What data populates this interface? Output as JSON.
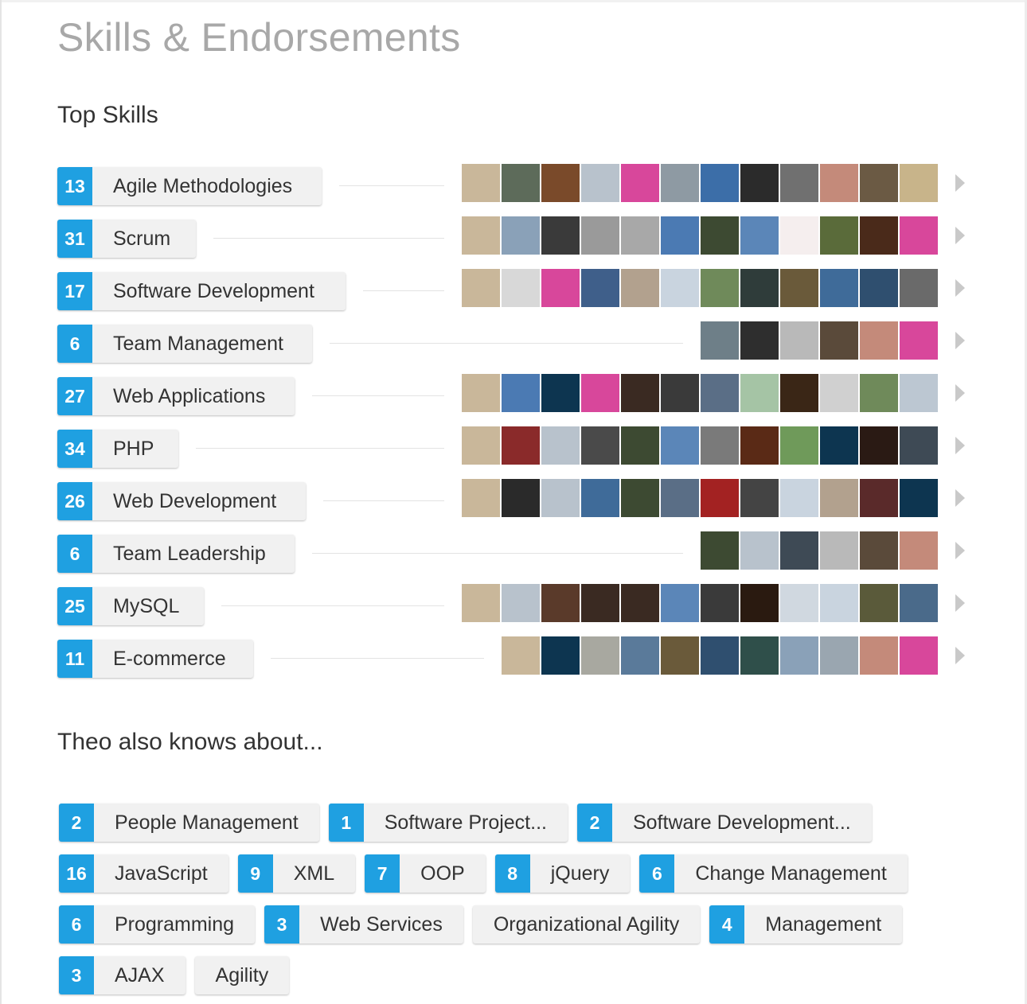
{
  "page": {
    "title": "Skills & Endorsements"
  },
  "top_skills": {
    "heading": "Top Skills",
    "items": [
      {
        "count": "13",
        "name": "Agile Methodologies",
        "endorser_colors": [
          "#c9b79a",
          "#5d6b5a",
          "#7a4a2a",
          "#b8c2cc",
          "#d8479b",
          "#8e9aa3",
          "#3c6ea8",
          "#2b2b2b",
          "#707070",
          "#c48a7a",
          "#6b5a44",
          "#c8b48a"
        ]
      },
      {
        "count": "31",
        "name": "Scrum",
        "endorser_colors": [
          "#c9b79a",
          "#8aa1b8",
          "#3a3a3a",
          "#9a9a9a",
          "#a8a8a8",
          "#4b7ab3",
          "#3d4a32",
          "#5b86b8",
          "#f5eeee",
          "#5a6b3a",
          "#4a2a1a",
          "#d8479b"
        ]
      },
      {
        "count": "17",
        "name": "Software Development",
        "endorser_colors": [
          "#c9b79a",
          "#d8d8d8",
          "#d8479b",
          "#3f5f8a",
          "#b2a18e",
          "#c9d4df",
          "#6f8a5a",
          "#2f3c3a",
          "#6a5a3a",
          "#3f6b99",
          "#2f4f6f",
          "#6a6a6a"
        ]
      },
      {
        "count": "6",
        "name": "Team Management",
        "endorser_colors": [
          "#6e7f88",
          "#2e2e2e",
          "#b9b9b9",
          "#5a4a3a",
          "#c48a7a",
          "#d8479b"
        ]
      },
      {
        "count": "27",
        "name": "Web Applications",
        "endorser_colors": [
          "#c9b79a",
          "#4b7ab3",
          "#0d3550",
          "#d8479b",
          "#3a2a22",
          "#3a3a3a",
          "#5a6e86",
          "#a5c4a5",
          "#3a2616",
          "#d0d0d0",
          "#6f8a5a",
          "#bcc7d2"
        ]
      },
      {
        "count": "34",
        "name": "PHP",
        "endorser_colors": [
          "#c9b79a",
          "#8a2a2a",
          "#b8c2cc",
          "#4a4a4a",
          "#3d4a32",
          "#5b86b8",
          "#7a7a7a",
          "#5a2a16",
          "#6f9a5a",
          "#0d3550",
          "#2a1a14",
          "#3e4a55"
        ]
      },
      {
        "count": "26",
        "name": "Web Development",
        "endorser_colors": [
          "#c9b79a",
          "#2a2a2a",
          "#b8c2cc",
          "#3f6b99",
          "#3d4a32",
          "#5a6e86",
          "#a32222",
          "#444444",
          "#c9d4df",
          "#b2a18e",
          "#5a2a2a",
          "#0d3550"
        ]
      },
      {
        "count": "6",
        "name": "Team Leadership",
        "endorser_colors": [
          "#3d4a32",
          "#b8c2cc",
          "#3e4a55",
          "#b9b9b9",
          "#5a4a3a",
          "#c48a7a"
        ]
      },
      {
        "count": "25",
        "name": "MySQL",
        "endorser_colors": [
          "#c9b79a",
          "#b8c2cc",
          "#5a3a2a",
          "#3a2a22",
          "#3a2a22",
          "#5b86b8",
          "#3a3a3a",
          "#2a1a10",
          "#d0d8e0",
          "#c9d4df",
          "#5a5a3a",
          "#4a6a8a"
        ]
      },
      {
        "count": "11",
        "name": "E-commerce",
        "endorser_colors": [
          "#c9b79a",
          "#0d3550",
          "#a8a8a0",
          "#5a7a9a",
          "#6a5a3a",
          "#2f4f6f",
          "#2f4f4a",
          "#8aa1b8",
          "#9aa6b0",
          "#c48a7a",
          "#d8479b"
        ]
      }
    ]
  },
  "also_knows": {
    "heading": "Theo also knows about...",
    "rows": [
      [
        {
          "count": "2",
          "name": "People Management"
        },
        {
          "count": "1",
          "name": "Software Project..."
        },
        {
          "count": "2",
          "name": "Software Development..."
        }
      ],
      [
        {
          "count": "16",
          "name": "JavaScript"
        },
        {
          "count": "9",
          "name": "XML"
        },
        {
          "count": "7",
          "name": "OOP"
        },
        {
          "count": "8",
          "name": "jQuery"
        },
        {
          "count": "6",
          "name": "Change Management"
        }
      ],
      [
        {
          "count": "6",
          "name": "Programming"
        },
        {
          "count": "3",
          "name": "Web Services"
        },
        {
          "count": "",
          "name": "Organizational Agility"
        },
        {
          "count": "4",
          "name": "Management"
        }
      ],
      [
        {
          "count": "3",
          "name": "AJAX"
        },
        {
          "count": "",
          "name": "Agility"
        }
      ]
    ]
  },
  "colors": {
    "count_badge": "#1fa0e1",
    "pill_bg": "#f1f1f1",
    "title": "#a8a8a8"
  }
}
